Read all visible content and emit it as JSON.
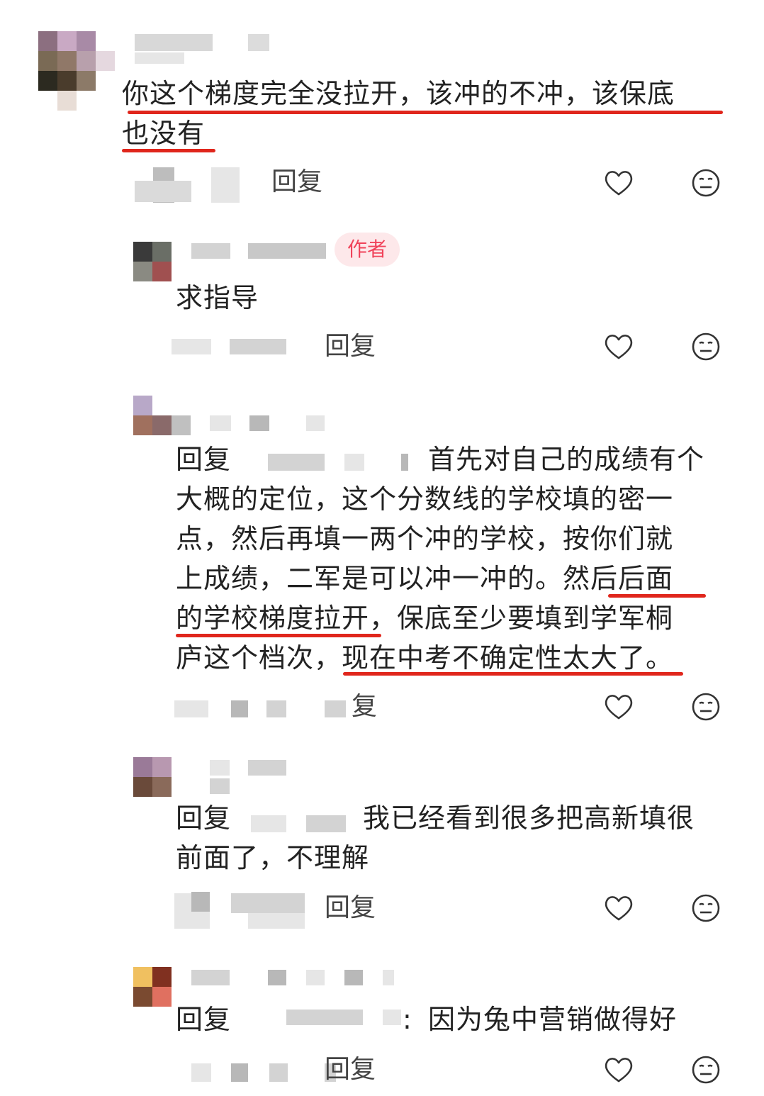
{
  "comment": {
    "text_line1": "你这个梯度完全没拉开，该冲的不冲，该保底",
    "text_line2": "也没有",
    "reply_label": "回复"
  },
  "replies": [
    {
      "author_badge": "作者",
      "text_line1": "求指导",
      "reply_label": "回复"
    },
    {
      "prefix": "回复",
      "lines": [
        "首先对自己的成绩有个",
        "大概的定位，这个分数线的学校填的密一",
        "点，然后再填一两个冲的学校，按你们就",
        "上成绩，二军是可以冲一冲的。然后后面",
        "的学校梯度拉开，保底至少要填到学军桐",
        "庐这个档次，现在中考不确定性太大了。"
      ],
      "reply_label": "复"
    },
    {
      "prefix": "回复",
      "lines": [
        "我已经看到很多把高新填很",
        "前面了，不理解"
      ],
      "reply_label": "回复"
    },
    {
      "prefix": "回复",
      "lines": [
        "因为兔中营销做得好"
      ],
      "colon": ":",
      "reply_label": "回复"
    }
  ],
  "icons": [
    "heart-icon",
    "emoji-icon"
  ],
  "colors": {
    "underline": "#e0261c",
    "badge_bg": "#fde8ea",
    "badge_text": "#f0435a"
  }
}
